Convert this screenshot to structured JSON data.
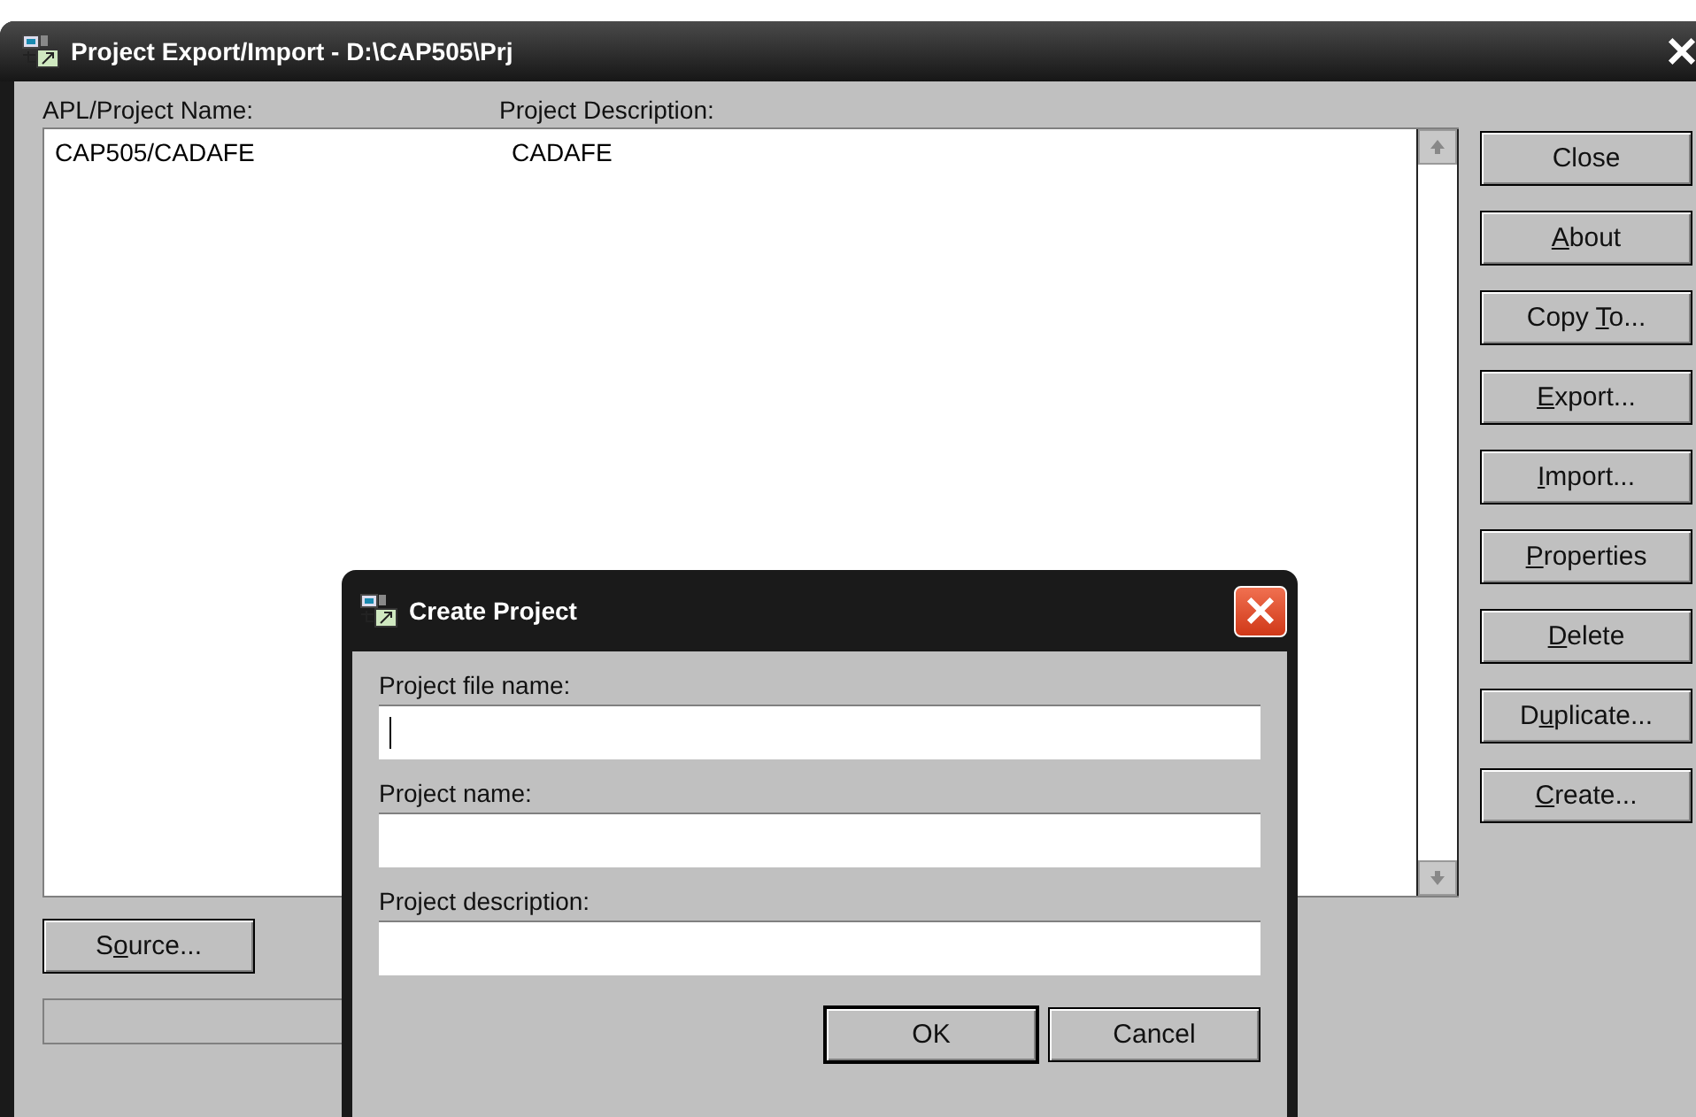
{
  "window": {
    "title": "Project Export/Import - D:\\CAP505\\Prj"
  },
  "list": {
    "columns": [
      "APL/Project Name:",
      "Project Description:"
    ],
    "rows": [
      {
        "cells": [
          "CAP505/CADAFE",
          "CADAFE"
        ]
      }
    ]
  },
  "side_buttons": [
    {
      "after": "Close"
    },
    {
      "key": "A",
      "after": "bout"
    },
    {
      "before": "Copy ",
      "key": "T",
      "after": "o..."
    },
    {
      "key": "E",
      "after": "xport..."
    },
    {
      "key": "I",
      "after": "mport..."
    },
    {
      "key": "P",
      "after": "roperties"
    },
    {
      "key": "D",
      "after": "elete"
    },
    {
      "before": "D",
      "key": "u",
      "after": "plicate..."
    },
    {
      "key": "C",
      "after": "reate..."
    }
  ],
  "source_button": {
    "before": "S",
    "key": "o",
    "after": "urce..."
  },
  "dialog": {
    "title": "Create Project",
    "fields": [
      {
        "label": "Project file name:",
        "focused": true
      },
      {
        "label": "Project name:",
        "focused": false
      },
      {
        "label": "Project description:",
        "focused": false
      }
    ],
    "buttons": [
      {
        "label": "OK",
        "default": true
      },
      {
        "label": "Cancel",
        "default": false
      }
    ]
  }
}
